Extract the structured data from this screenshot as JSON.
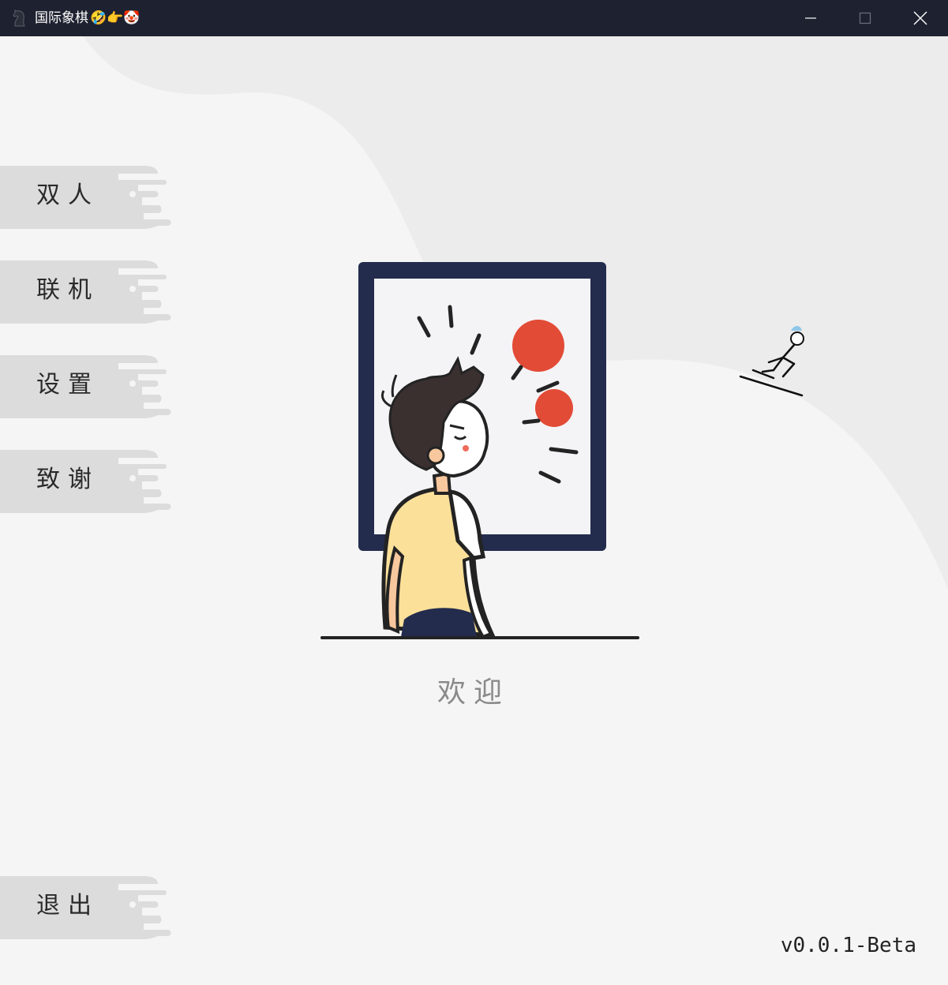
{
  "window": {
    "title": "国际象棋",
    "title_emoji": "🤣👉🤡",
    "controls": [
      "minimize",
      "maximize",
      "close"
    ]
  },
  "menu": {
    "items": [
      {
        "label": "双人"
      },
      {
        "label": "联机"
      },
      {
        "label": "设置"
      },
      {
        "label": "致谢"
      },
      {
        "label": "退出"
      }
    ]
  },
  "main": {
    "welcome_text": "欢迎",
    "version": "v0.0.1-Beta"
  },
  "colors": {
    "background": "#f5f5f5",
    "background_shape": "#ececec",
    "button": "#dcdcdc",
    "titlebar": "#1e2230",
    "frame": "#232c4d",
    "accent_red": "#e24b36",
    "shirt": "#fbe09a"
  }
}
